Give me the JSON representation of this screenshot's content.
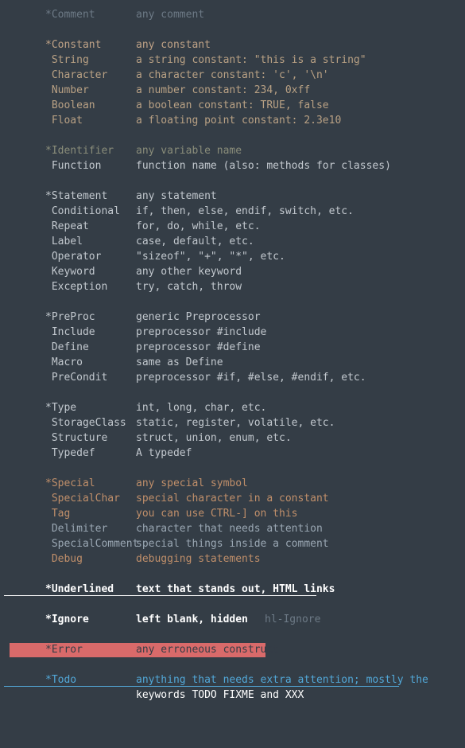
{
  "theme": {
    "background": "#343d46",
    "comment": "#6d7a86",
    "constant": "#c0a387",
    "identifier": "#8a8d7a",
    "normal": "#c2c8ce",
    "special": "#c08f6a",
    "underlined": "#ffffff",
    "error_background": "#d96a6a",
    "error_foreground": "#343d46",
    "todo": "#52a8d8"
  },
  "groups": [
    {
      "id": "comment",
      "rows": [
        {
          "name": "*Comment",
          "desc": "any comment",
          "style": "c-comment",
          "desc_style": "c-comment"
        }
      ]
    },
    {
      "id": "constant",
      "rows": [
        {
          "name": "*Constant",
          "desc": "any constant",
          "style": "c-constant",
          "desc_style": "c-constant"
        },
        {
          "name": " String",
          "desc": "a string constant: \"this is a string\"",
          "style": "c-string",
          "desc_style": "c-string"
        },
        {
          "name": " Character",
          "desc": "a character constant: 'c', '\\n'",
          "style": "c-string",
          "desc_style": "c-string"
        },
        {
          "name": " Number",
          "desc": "a number constant: 234, 0xff",
          "style": "c-string",
          "desc_style": "c-string"
        },
        {
          "name": " Boolean",
          "desc": "a boolean constant: TRUE, false",
          "style": "c-string",
          "desc_style": "c-string"
        },
        {
          "name": " Float",
          "desc": "a floating point constant: 2.3e10",
          "style": "c-string",
          "desc_style": "c-string"
        }
      ]
    },
    {
      "id": "identifier",
      "rows": [
        {
          "name": "*Identifier",
          "desc": "any variable name",
          "style": "c-identifier",
          "desc_style": "c-identifier"
        },
        {
          "name": " Function",
          "desc": "function name (also: methods for classes)",
          "style": "c-function",
          "desc_style": "c-function"
        }
      ]
    },
    {
      "id": "statement",
      "rows": [
        {
          "name": "*Statement",
          "desc": "any statement",
          "style": "c-statement",
          "desc_style": "c-statement"
        },
        {
          "name": " Conditional",
          "desc": "if, then, else, endif, switch, etc.",
          "style": "c-statement",
          "desc_style": "c-statement"
        },
        {
          "name": " Repeat",
          "desc": "for, do, while, etc.",
          "style": "c-statement",
          "desc_style": "c-statement"
        },
        {
          "name": " Label",
          "desc": "case, default, etc.",
          "style": "c-statement",
          "desc_style": "c-statement"
        },
        {
          "name": " Operator",
          "desc": "\"sizeof\", \"+\", \"*\", etc.",
          "style": "c-statement",
          "desc_style": "c-statement"
        },
        {
          "name": " Keyword",
          "desc": "any other keyword",
          "style": "c-statement",
          "desc_style": "c-statement"
        },
        {
          "name": " Exception",
          "desc": "try, catch, throw",
          "style": "c-statement",
          "desc_style": "c-statement"
        }
      ]
    },
    {
      "id": "preproc",
      "rows": [
        {
          "name": "*PreProc",
          "desc": "generic Preprocessor",
          "style": "c-preproc",
          "desc_style": "c-preproc"
        },
        {
          "name": " Include",
          "desc": "preprocessor #include",
          "style": "c-preproc",
          "desc_style": "c-preproc"
        },
        {
          "name": " Define",
          "desc": "preprocessor #define",
          "style": "c-preproc",
          "desc_style": "c-preproc"
        },
        {
          "name": " Macro",
          "desc": "same as Define",
          "style": "c-preproc",
          "desc_style": "c-preproc"
        },
        {
          "name": " PreCondit",
          "desc": "preprocessor #if, #else, #endif, etc.",
          "style": "c-preproc",
          "desc_style": "c-preproc"
        }
      ]
    },
    {
      "id": "type",
      "rows": [
        {
          "name": "*Type",
          "desc": "int, long, char, etc.",
          "style": "c-type",
          "desc_style": "c-type"
        },
        {
          "name": " StorageClass",
          "desc": "static, register, volatile, etc.",
          "style": "c-type",
          "desc_style": "c-type"
        },
        {
          "name": " Structure",
          "desc": "struct, union, enum, etc.",
          "style": "c-type",
          "desc_style": "c-type"
        },
        {
          "name": " Typedef",
          "desc": "A typedef",
          "style": "c-type",
          "desc_style": "c-type"
        }
      ]
    },
    {
      "id": "special",
      "rows": [
        {
          "name": "*Special",
          "desc": "any special symbol",
          "style": "c-special",
          "desc_style": "c-special"
        },
        {
          "name": " SpecialChar",
          "desc": "special character in a constant",
          "style": "c-special",
          "desc_style": "c-special"
        },
        {
          "name": " Tag",
          "desc": "you can use CTRL-] on this",
          "style": "c-special",
          "desc_style": "c-special"
        },
        {
          "name": " Delimiter",
          "desc": "character that needs attention",
          "style": "c-bluegray",
          "desc_style": "c-bluegray"
        },
        {
          "name": " SpecialComment",
          "desc": "special things inside a comment",
          "style": "c-bluegray",
          "desc_style": "c-bluegray"
        },
        {
          "name": " Debug",
          "desc": "debugging statements",
          "style": "c-special",
          "desc_style": "c-special"
        }
      ]
    }
  ],
  "underlined": {
    "name": "*Underlined",
    "desc": "text that stands out, HTML links"
  },
  "ignore": {
    "name": "*Ignore",
    "desc": "left blank, hidden",
    "extra": "hl-Ignore"
  },
  "error": {
    "name": "*Error",
    "desc": "any erroneous construct"
  },
  "todo": {
    "name": "*Todo",
    "desc_line1": "anything that needs extra attention; mostly the",
    "desc_line2": "keywords TODO FIXME and XXX"
  }
}
